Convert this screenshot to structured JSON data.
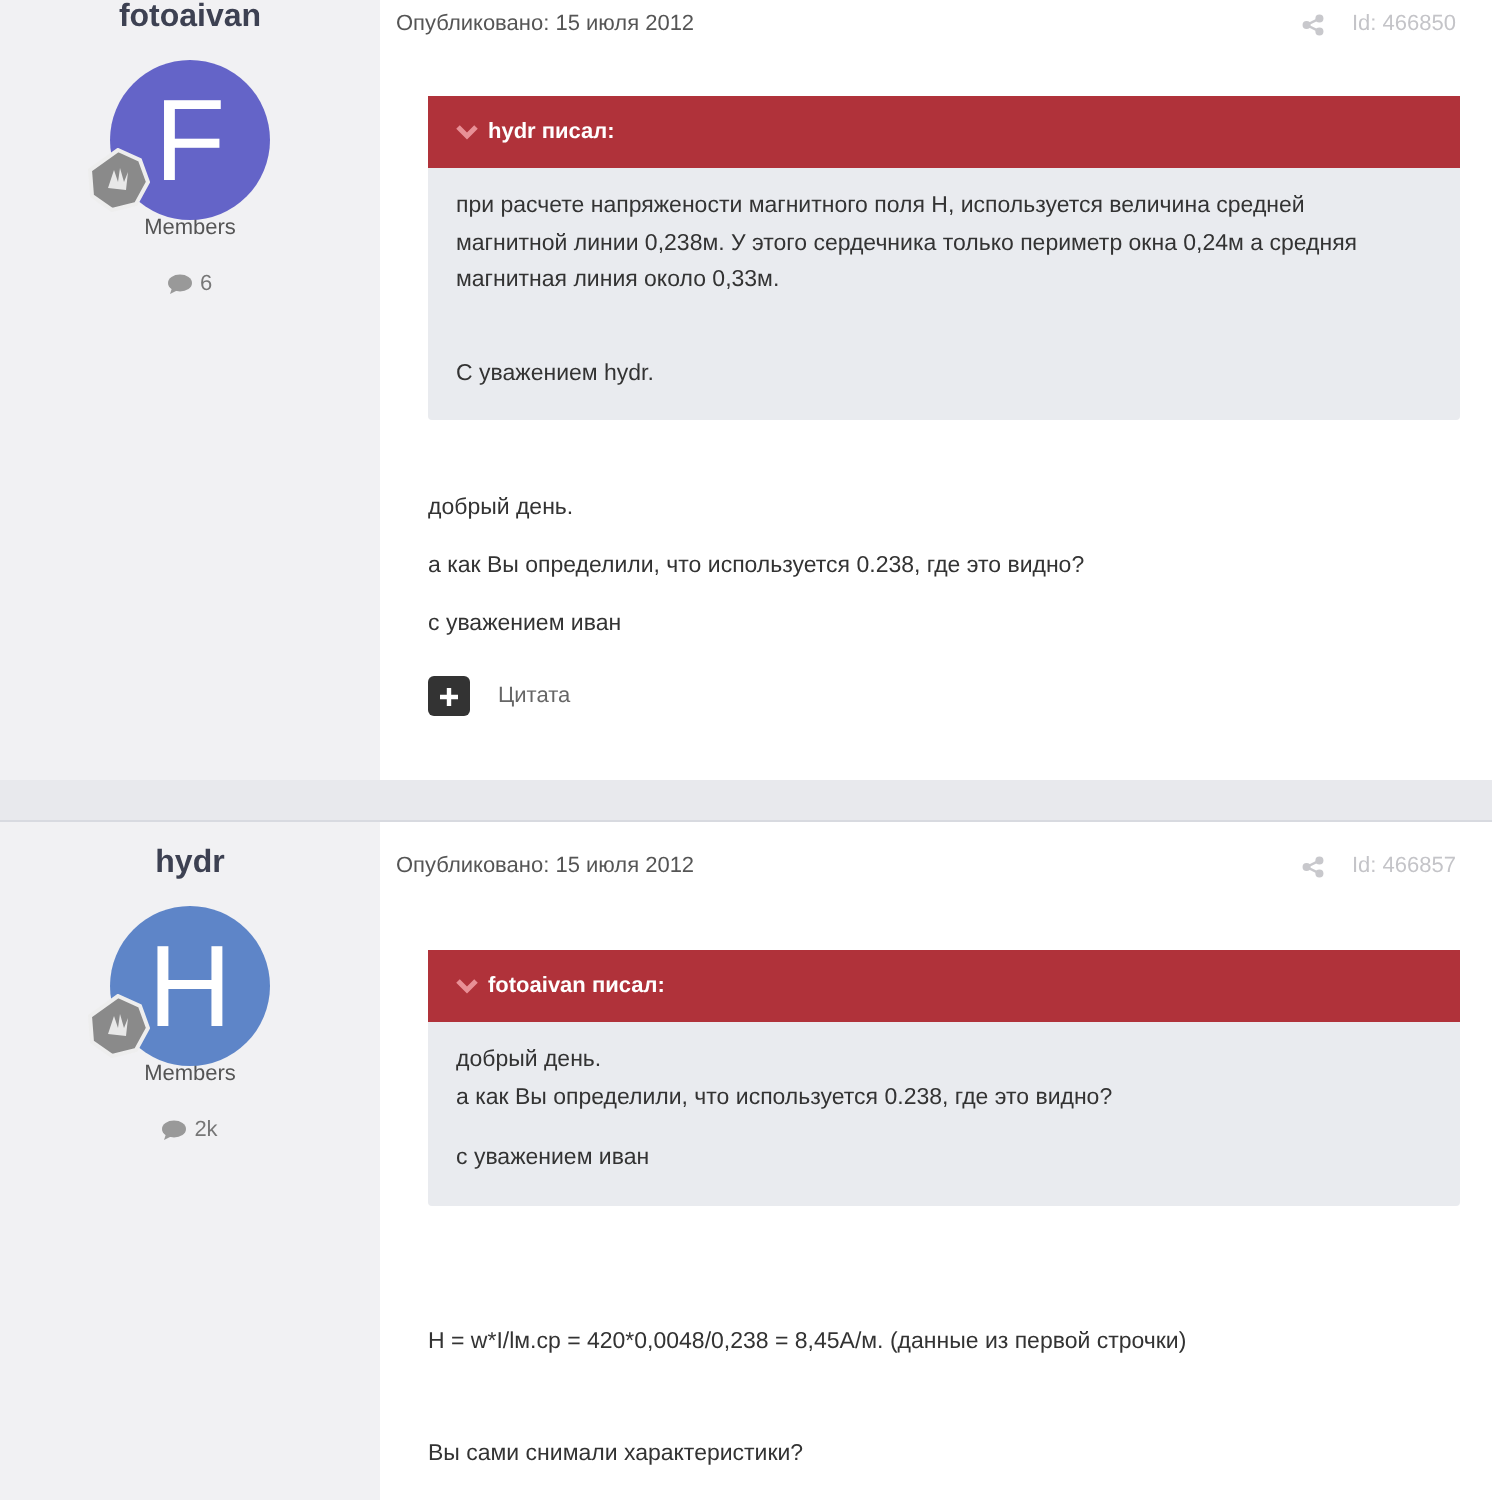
{
  "posts": [
    {
      "author": "fotoaivan",
      "avatar_letter": "F",
      "color": "#6464c8",
      "group": "Members",
      "comments": "6",
      "date": "Опубликовано: 15 июля 2012",
      "id": "Id: 466850",
      "quote": {
        "header": "hydr писал:",
        "paragraphs": [
          [
            "при расчете напряжености магнитного поля H, используется величина средней магнитной линии 0,238м. У этого сердечника только периметр окна 0,24м а средняя магнитная линия около 0,33м."
          ],
          [
            "С уважением hydr."
          ]
        ]
      },
      "body": [
        "добрый день.",
        "а как Вы определили, что используется 0.238, где это видно?",
        "с уважением иван"
      ],
      "quote_button": "Цитата"
    },
    {
      "author": "hydr",
      "avatar_letter": "H",
      "color": "#5e85c8",
      "group": "Members",
      "comments": "2k",
      "date": "Опубликовано: 15 июля 2012",
      "id": "Id: 466857",
      "quote": {
        "header": "fotoaivan писал:",
        "paragraphs": [
          [
            "добрый день.",
            "а как Вы определили, что используется 0.238, где это видно?"
          ],
          [
            "с уважением иван"
          ]
        ]
      },
      "body": [
        "H = w*I/lм.ср = 420*0,0048/0,238 = 8,45А/м. (данные из первой строчки)",
        "Вы сами снимали характеристики?"
      ]
    }
  ]
}
